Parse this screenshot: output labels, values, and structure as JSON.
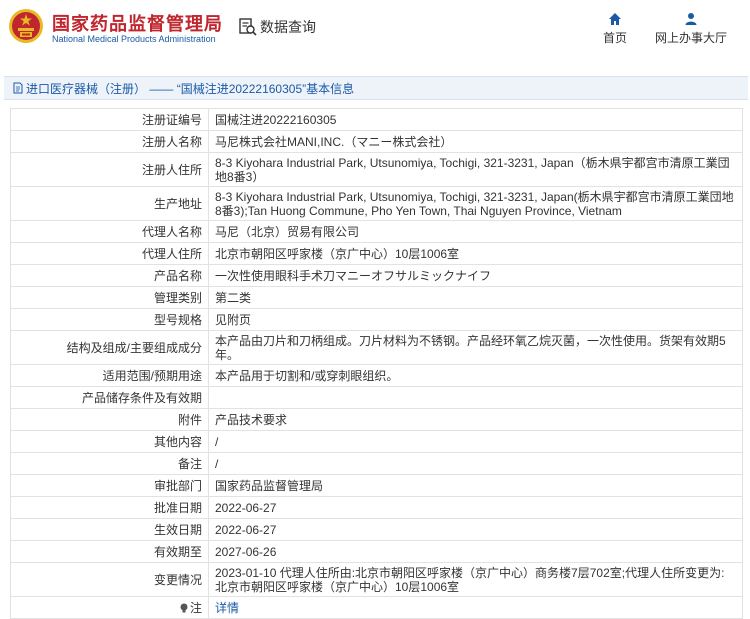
{
  "header": {
    "brand_cn": "国家药品监督管理局",
    "brand_en": "National Medical Products Administration",
    "query_label": "数据查询",
    "nav_home": "首页",
    "nav_hall": "网上办事大厅",
    "logo_icon": "emblem-icon",
    "query_icon": "data-search-icon",
    "home_icon": "home-icon",
    "hall_icon": "user-icon"
  },
  "breadcrumb": {
    "category": "进口医疗器械（注册）",
    "separator": "——",
    "record_title": "“国械注进20222160305”基本信息",
    "doc_icon": "document-icon"
  },
  "colors": {
    "brand_red": "#c0262d",
    "link_blue": "#1a5aa6",
    "title_bg": "#eef3fa",
    "border": "#e2e2e2"
  },
  "record": {
    "rows": [
      {
        "label": "注册证编号",
        "value": "国械注进20222160305"
      },
      {
        "label": "注册人名称",
        "value": "马尼株式会社MANI,INC.（マニー株式会社）"
      },
      {
        "label": "注册人住所",
        "value": "8-3 Kiyohara Industrial Park, Utsunomiya, Tochigi, 321-3231, Japan（栃木県宇都宫市清原工業団地8番3）"
      },
      {
        "label": "生产地址",
        "value": "8-3 Kiyohara Industrial Park, Utsunomiya, Tochigi, 321-3231, Japan(栃木県宇都宫市清原工業団地8番3);Tan Huong Commune, Pho Yen Town, Thai Nguyen Province, Vietnam"
      },
      {
        "label": "代理人名称",
        "value": "马尼（北京）贸易有限公司"
      },
      {
        "label": "代理人住所",
        "value": "北京市朝阳区呼家楼（京广中心）10层1006室"
      },
      {
        "label": "产品名称",
        "value": "一次性使用眼科手术刀マニーオフサルミックナイフ"
      },
      {
        "label": "管理类别",
        "value": "第二类"
      },
      {
        "label": "型号规格",
        "value": "见附页"
      },
      {
        "label": "结构及组成/主要组成成分",
        "value": "本产品由刀片和刀柄组成。刀片材料为不锈钢。产品经环氧乙烷灭菌，一次性使用。货架有效期5年。"
      },
      {
        "label": "适用范围/预期用途",
        "value": "本产品用于切割和/或穿刺眼组织。"
      },
      {
        "label": "产品储存条件及有效期",
        "value": ""
      },
      {
        "label": "附件",
        "value": "产品技术要求"
      },
      {
        "label": "其他内容",
        "value": "/"
      },
      {
        "label": "备注",
        "value": "/"
      },
      {
        "label": "审批部门",
        "value": "国家药品监督管理局"
      },
      {
        "label": "批准日期",
        "value": "2022-06-27"
      },
      {
        "label": "生效日期",
        "value": "2022-06-27"
      },
      {
        "label": "有效期至",
        "value": "2027-06-26"
      },
      {
        "label": "变更情况",
        "value": "2023-01-10 代理人住所由:北京市朝阳区呼家楼（京广中心）商务楼7层702室;代理人住所变更为:北京市朝阳区呼家楼（京广中心）10层1006室"
      }
    ],
    "note_label": "注",
    "note_icon": "bulb-icon",
    "note_link": "详情"
  }
}
